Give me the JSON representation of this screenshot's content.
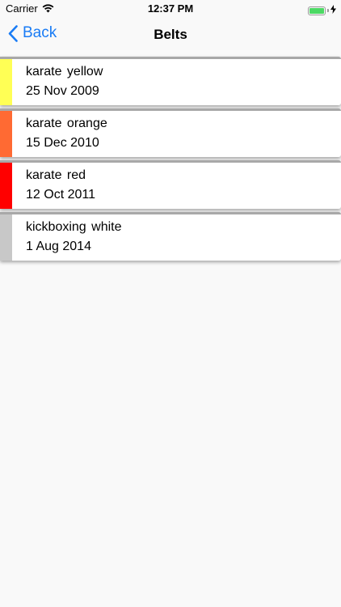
{
  "status_bar": {
    "carrier": "Carrier",
    "time": "12:37 PM",
    "battery_color": "#4cd964"
  },
  "nav": {
    "back_label": "Back",
    "title": "Belts",
    "accent": "#1a7cf5"
  },
  "belts": [
    {
      "name": "karate yellow",
      "date": "25 Nov 2009",
      "color": "#ffff55"
    },
    {
      "name": "karate orange",
      "date": "15 Dec 2010",
      "color": "#ff6a33"
    },
    {
      "name": "karate red",
      "date": "12 Oct 2011",
      "color": "#ff0000"
    },
    {
      "name": "kickboxing white",
      "date": "1 Aug 2014",
      "color": "#c8c8c8"
    }
  ]
}
